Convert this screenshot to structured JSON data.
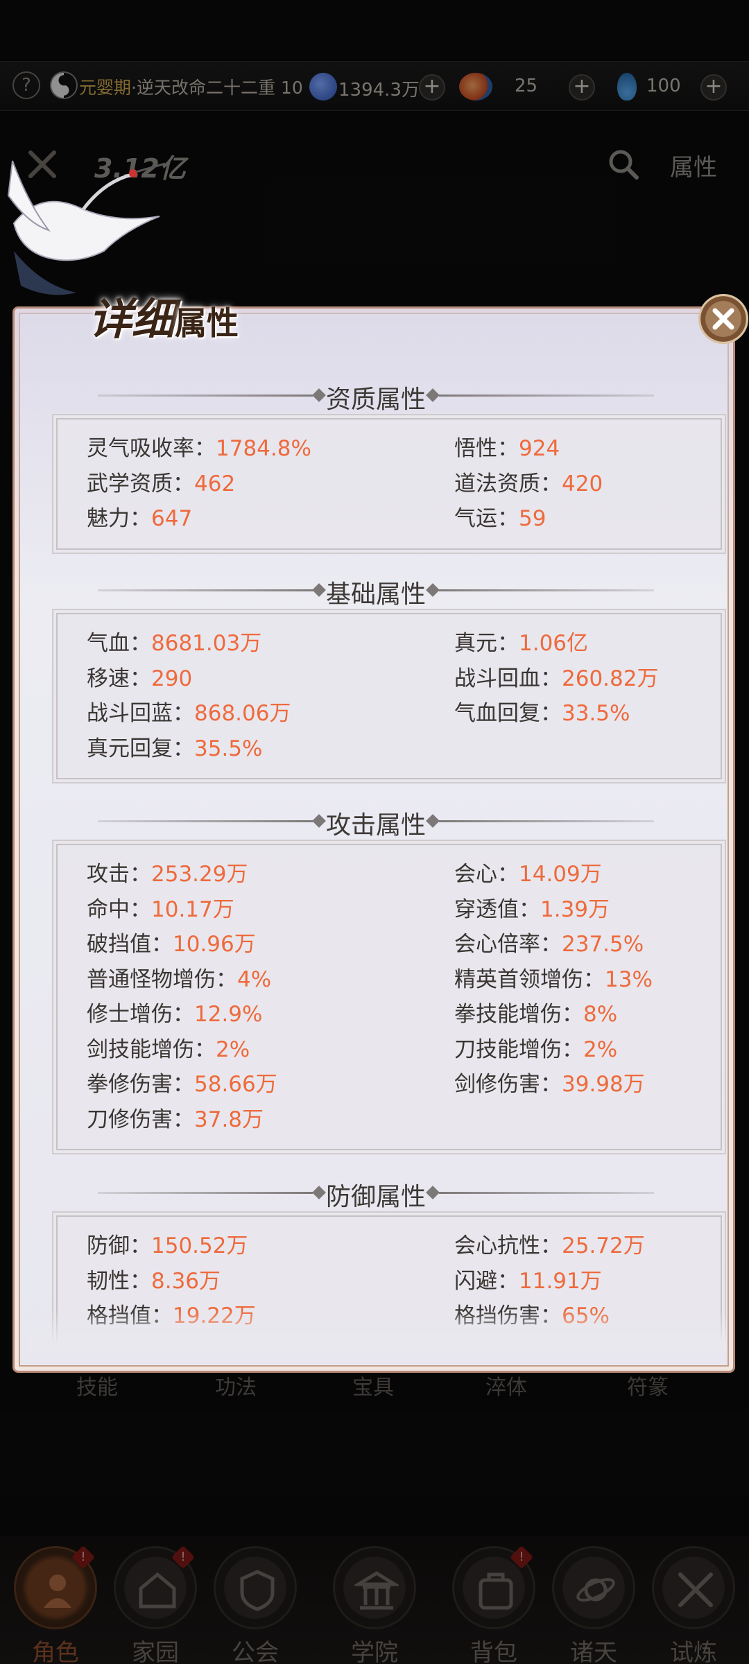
{
  "topbar": {
    "help_icon": "?",
    "realm_label": "元婴期",
    "realm_rest": "·逆天改命二十二重 10",
    "currencies": [
      {
        "name": "star-coin",
        "value": "1394.3万",
        "color": "#3f6fd0"
      },
      {
        "name": "spirit-orb",
        "value": "25",
        "color": "#d35a2a"
      },
      {
        "name": "gourd",
        "value": "100",
        "color": "#3b8fd6"
      }
    ],
    "plus": "+"
  },
  "powerbar": {
    "power": "3.12亿",
    "attr_label": "属性"
  },
  "modal": {
    "title_big": "详细",
    "title_small": "属性",
    "sections": [
      {
        "title": "资质属性",
        "rows": [
          [
            {
              "k": "灵气吸收率：",
              "v": "1784.8%"
            },
            {
              "k": "悟性：",
              "v": "924"
            }
          ],
          [
            {
              "k": "武学资质：",
              "v": "462"
            },
            {
              "k": "道法资质：",
              "v": "420"
            }
          ],
          [
            {
              "k": "魅力：",
              "v": "647"
            },
            {
              "k": "气运：",
              "v": "59"
            }
          ]
        ]
      },
      {
        "title": "基础属性",
        "rows": [
          [
            {
              "k": "气血：",
              "v": "8681.03万"
            },
            {
              "k": "真元：",
              "v": "1.06亿"
            }
          ],
          [
            {
              "k": "移速：",
              "v": "290"
            },
            {
              "k": "战斗回血：",
              "v": "260.82万"
            }
          ],
          [
            {
              "k": "战斗回蓝：",
              "v": "868.06万"
            },
            {
              "k": "气血回复：",
              "v": "33.5%"
            }
          ],
          [
            {
              "k": "真元回复：",
              "v": "35.5%"
            }
          ]
        ]
      },
      {
        "title": "攻击属性",
        "rows": [
          [
            {
              "k": "攻击：",
              "v": "253.29万"
            },
            {
              "k": "会心：",
              "v": "14.09万"
            }
          ],
          [
            {
              "k": "命中：",
              "v": "10.17万"
            },
            {
              "k": "穿透值：",
              "v": "1.39万"
            }
          ],
          [
            {
              "k": "破挡值：",
              "v": "10.96万"
            },
            {
              "k": "会心倍率：",
              "v": "237.5%"
            }
          ],
          [
            {
              "k": "普通怪物增伤：",
              "v": "4%"
            },
            {
              "k": "精英首领增伤：",
              "v": "13%"
            }
          ],
          [
            {
              "k": "修士增伤：",
              "v": "12.9%"
            },
            {
              "k": "拳技能增伤：",
              "v": "8%"
            }
          ],
          [
            {
              "k": "剑技能增伤：",
              "v": "2%"
            },
            {
              "k": "刀技能增伤：",
              "v": "2%"
            }
          ],
          [
            {
              "k": "拳修伤害：",
              "v": "58.66万"
            },
            {
              "k": "剑修伤害：",
              "v": "39.98万"
            }
          ],
          [
            {
              "k": "刀修伤害：",
              "v": "37.8万"
            }
          ]
        ]
      },
      {
        "title": "防御属性",
        "rows": [
          [
            {
              "k": "防御：",
              "v": "150.52万"
            },
            {
              "k": "会心抗性：",
              "v": "25.72万"
            }
          ],
          [
            {
              "k": "韧性：",
              "v": "8.36万"
            },
            {
              "k": "闪避：",
              "v": "11.91万"
            }
          ],
          [
            {
              "k": "格挡值：",
              "v": "19.22万"
            },
            {
              "k": "格挡伤害：",
              "v": "65%"
            }
          ]
        ]
      }
    ]
  },
  "tabs": [
    "技能",
    "功法",
    "宝具",
    "淬体",
    "符篆"
  ],
  "nav": [
    {
      "label": "角色",
      "icon": "character-icon",
      "active": true,
      "badge": true
    },
    {
      "label": "家园",
      "icon": "home-icon",
      "active": false,
      "badge": true
    },
    {
      "label": "公会",
      "icon": "guild-icon",
      "active": false,
      "badge": false
    },
    {
      "label": "学院",
      "icon": "academy-icon",
      "active": false,
      "badge": false
    },
    {
      "label": "背包",
      "icon": "backpack-icon",
      "active": false,
      "badge": true
    },
    {
      "label": "诸天",
      "icon": "worlds-icon",
      "active": false,
      "badge": false
    },
    {
      "label": "试炼",
      "icon": "trial-icon",
      "active": false,
      "badge": false
    }
  ],
  "colors": {
    "value_orange": "#ee6a3c",
    "key_text": "#3a3633",
    "modal_border": "#b88b78"
  }
}
